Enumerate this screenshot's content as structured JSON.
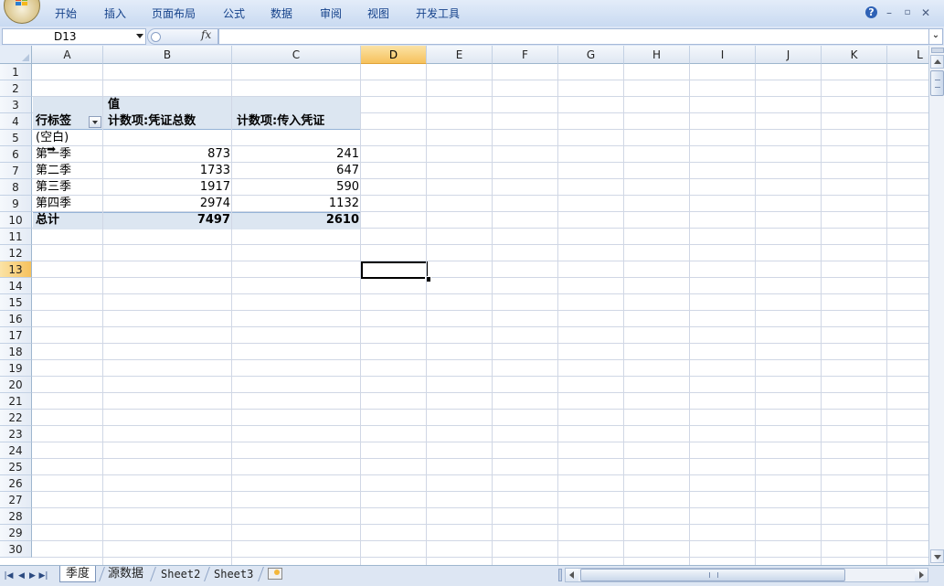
{
  "ribbon": {
    "tabs": [
      "开始",
      "插入",
      "页面布局",
      "公式",
      "数据",
      "审阅",
      "视图",
      "开发工具"
    ],
    "controls": {
      "help": "?",
      "minimize": "–",
      "restore": "▫",
      "close": "✕"
    }
  },
  "formula_bar": {
    "name_box": "D13",
    "fx_label": "fx",
    "formula": ""
  },
  "columns": [
    "A",
    "B",
    "C",
    "D",
    "E",
    "F",
    "G",
    "H",
    "I",
    "J",
    "K",
    "L"
  ],
  "selected_column": "D",
  "rows": [
    "1",
    "2",
    "3",
    "4",
    "5",
    "6",
    "7",
    "8",
    "9",
    "10",
    "11",
    "12",
    "13",
    "14",
    "15",
    "16",
    "17",
    "18",
    "19",
    "20",
    "21",
    "22",
    "23",
    "24",
    "25",
    "26",
    "27",
    "28",
    "29",
    "30"
  ],
  "selected_row": "13",
  "pivot": {
    "values_header": "值",
    "row_label_header": "行标签",
    "col_headers": [
      "计数项:凭证总数",
      "计数项:传入凭证"
    ],
    "rows": [
      {
        "label": "(空白)",
        "b": "",
        "c": ""
      },
      {
        "label": "第一季",
        "b": "873",
        "c": "241"
      },
      {
        "label": "第二季",
        "b": "1733",
        "c": "647"
      },
      {
        "label": "第三季",
        "b": "1917",
        "c": "590"
      },
      {
        "label": "第四季",
        "b": "2974",
        "c": "1132"
      }
    ],
    "total": {
      "label": "总计",
      "b": "7497",
      "c": "2610"
    }
  },
  "sheets": [
    "季度",
    "源数据",
    "Sheet2",
    "Sheet3"
  ],
  "active_sheet": "季度",
  "colors": {
    "selected_header": "#f6c15c",
    "pivot_band": "#dce6f1",
    "ribbon_text": "#15428b"
  }
}
